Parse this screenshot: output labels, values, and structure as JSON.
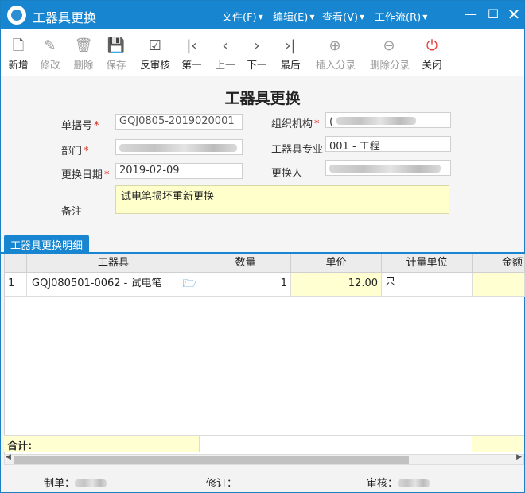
{
  "window": {
    "title": "工器具更换"
  },
  "menu": [
    {
      "label": "文件(F)"
    },
    {
      "label": "编辑(E)"
    },
    {
      "label": "查看(V)"
    },
    {
      "label": "工作流(R)"
    }
  ],
  "toolbar": [
    {
      "label": "新增",
      "icon": "new-doc-icon"
    },
    {
      "label": "修改",
      "icon": "edit-icon"
    },
    {
      "label": "删除",
      "icon": "trash-icon"
    },
    {
      "label": "保存",
      "icon": "save-icon"
    },
    {
      "label": "反审核",
      "icon": "unaudit-icon"
    },
    {
      "label": "第一",
      "icon": "first-icon"
    },
    {
      "label": "上一",
      "icon": "prev-icon"
    },
    {
      "label": "下一",
      "icon": "next-icon"
    },
    {
      "label": "最后",
      "icon": "last-icon"
    },
    {
      "label": "插入分录",
      "icon": "insert-row-icon"
    },
    {
      "label": "删除分录",
      "icon": "delete-row-icon"
    },
    {
      "label": "关闭",
      "icon": "power-icon"
    }
  ],
  "form": {
    "title": "工器具更换",
    "doc_no_label": "单据号",
    "doc_no_value": "GQJ0805-2019020001",
    "org_label": "组织机构",
    "org_value_prefix": "(",
    "dept_label": "部门",
    "tool_major_label": "工器具专业",
    "tool_major_value": "001 - 工程",
    "date_label": "更换日期",
    "date_value": "2019-02-09",
    "changer_label": "更换人",
    "remark_label": "备注",
    "remark_value": "试电笔损坏重新更换"
  },
  "tab": {
    "label": "工器具更换明细"
  },
  "grid": {
    "columns": [
      "工器具",
      "数量",
      "单价",
      "计量单位",
      "金额"
    ],
    "rows": [
      {
        "index": "1",
        "tool": "GQJ080501-0062 - 试电笔",
        "qty": "1",
        "price": "12.00",
        "unit": "只",
        "amount": ""
      }
    ],
    "total_label": "合计:"
  },
  "footer": {
    "maker_label": "制单：",
    "revise_label": "修订：",
    "audit_label": "审核："
  },
  "colors": {
    "accent": "#1785cf",
    "required": "#d9261c",
    "highlight": "#ffffd2"
  }
}
